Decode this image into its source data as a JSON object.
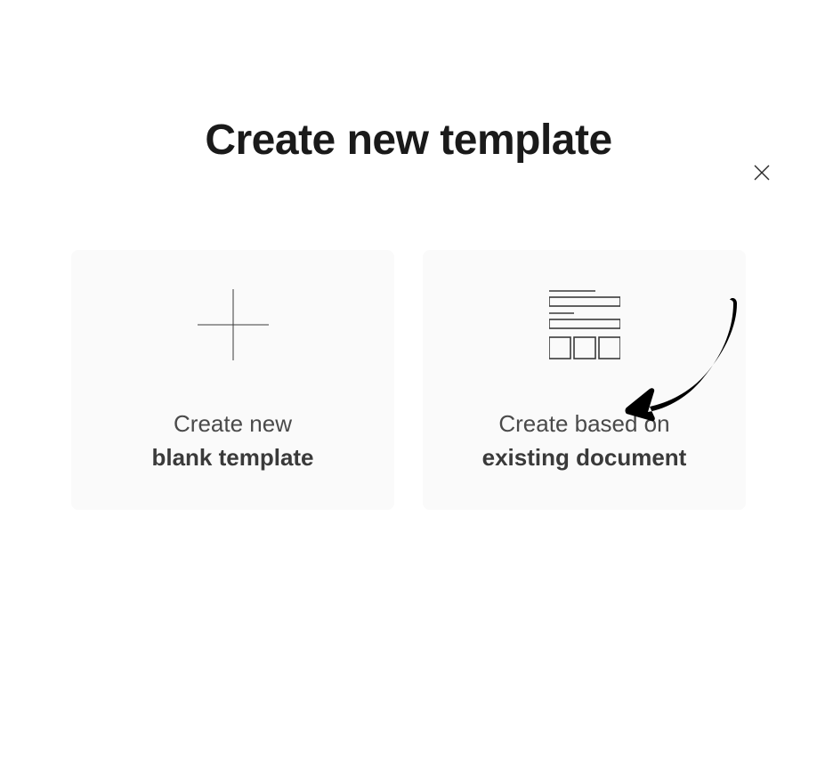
{
  "modal": {
    "title": "Create new template",
    "options": {
      "blank": {
        "line1": "Create new",
        "line2": "blank template"
      },
      "existing": {
        "line1": "Create based on",
        "line2": "existing document"
      }
    }
  }
}
